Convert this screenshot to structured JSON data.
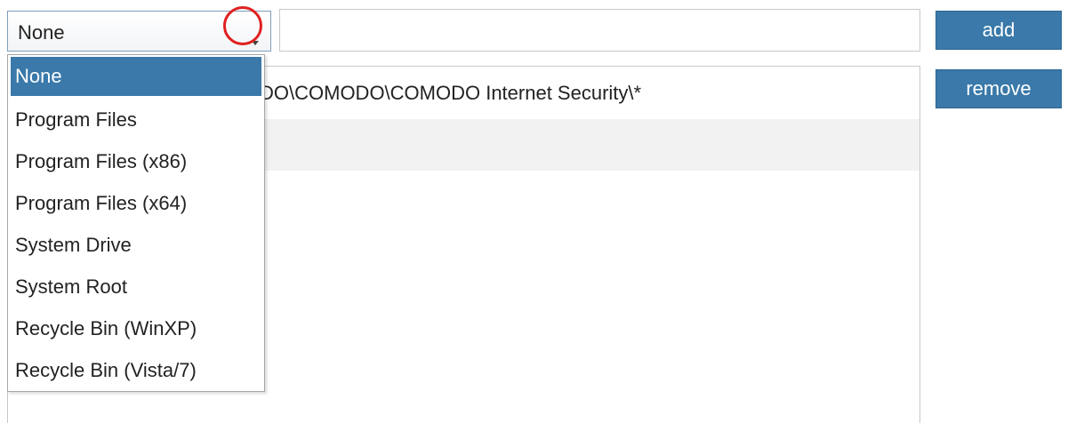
{
  "combo": {
    "selected_value": "None"
  },
  "path_input": {
    "value": ""
  },
  "buttons": {
    "add_label": "add",
    "remove_label": "remove"
  },
  "list": {
    "rows": [
      {
        "text": "DO\\COMODO\\COMODO Internet Security\\*"
      },
      {
        "text": ""
      }
    ]
  },
  "dropdown": {
    "items": [
      {
        "label": "None",
        "selected": true
      },
      {
        "label": "Program Files"
      },
      {
        "label": "Program Files (x86)"
      },
      {
        "label": "Program Files (x64)"
      },
      {
        "label": "System Drive"
      },
      {
        "label": "System Root"
      },
      {
        "label": "Recycle Bin (WinXP)"
      },
      {
        "label": "Recycle Bin (Vista/7)"
      }
    ]
  },
  "colors": {
    "accent": "#3a79a9",
    "highlight_circle": "#e02020"
  },
  "icons": {
    "combo_arrow": "chevron-down-icon"
  }
}
